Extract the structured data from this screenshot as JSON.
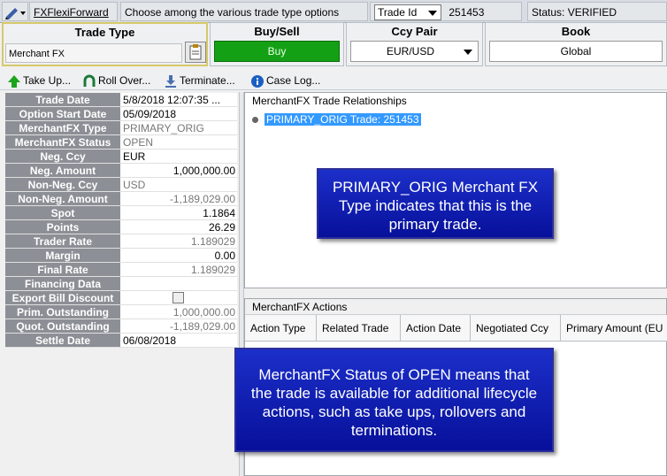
{
  "topbar": {
    "form_name": "FXFlexiForward",
    "hint": "Choose among the various trade type options",
    "id_selector": "Trade Id",
    "id_value": "251453",
    "status": "Status: VERIFIED"
  },
  "header": {
    "trade_type": {
      "title": "Trade Type",
      "value": "Merchant FX"
    },
    "buy_sell": {
      "title": "Buy/Sell",
      "value": "Buy"
    },
    "ccy_pair": {
      "title": "Ccy Pair",
      "value": "EUR/USD"
    },
    "book": {
      "title": "Book",
      "value": "Global"
    }
  },
  "toolbar": {
    "take_up": "Take Up...",
    "roll_over": "Roll Over...",
    "terminate": "Terminate...",
    "case_log": "Case Log..."
  },
  "fields": [
    {
      "label": "Trade Date",
      "value": "5/8/2018 12:07:35 ..."
    },
    {
      "label": "Option Start Date",
      "value": "05/09/2018"
    },
    {
      "label": "MerchantFX Type",
      "value": "PRIMARY_ORIG"
    },
    {
      "label": "MerchantFX Status",
      "value": "OPEN"
    },
    {
      "label": "Neg. Ccy",
      "value": "EUR"
    },
    {
      "label": "Neg. Amount",
      "value": "1,000,000.00"
    },
    {
      "label": "Non-Neg. Ccy",
      "value": "USD"
    },
    {
      "label": "Non-Neg. Amount",
      "value": "-1,189,029.00"
    },
    {
      "label": "Spot",
      "value": "1.1864"
    },
    {
      "label": "Points",
      "value": "26.29"
    },
    {
      "label": "Trader Rate",
      "value": "1.189029"
    },
    {
      "label": "Margin",
      "value": "0.00"
    },
    {
      "label": "Final Rate",
      "value": "1.189029"
    },
    {
      "label": "Financing Data",
      "value": ""
    },
    {
      "label": "Export Bill Discount",
      "value": ""
    },
    {
      "label": "Prim. Outstanding",
      "value": "1,000,000.00"
    },
    {
      "label": "Quot. Outstanding",
      "value": "-1,189,029.00"
    },
    {
      "label": "Settle Date",
      "value": "06/08/2018"
    }
  ],
  "relationships": {
    "title": "MerchantFX Trade Relationships",
    "item": "PRIMARY_ORIG Trade: 251453"
  },
  "actions": {
    "title": "MerchantFX Actions",
    "columns": [
      "Action Type",
      "Related Trade",
      "Action Date",
      "Negotiated Ccy",
      "Primary Amount (EU"
    ]
  },
  "callouts": {
    "type_note": "PRIMARY_ORIG Merchant FX Type indicates that this is the primary trade.",
    "status_note": "MerchantFX Status of OPEN means that the trade is available for additional lifecycle actions, such as take ups, rollovers and terminations."
  },
  "colors": {
    "buy_green": "#14a014",
    "selection_blue": "#3399ff",
    "callout_blue": "#0a16b0",
    "label_grey": "#8c8f95"
  }
}
